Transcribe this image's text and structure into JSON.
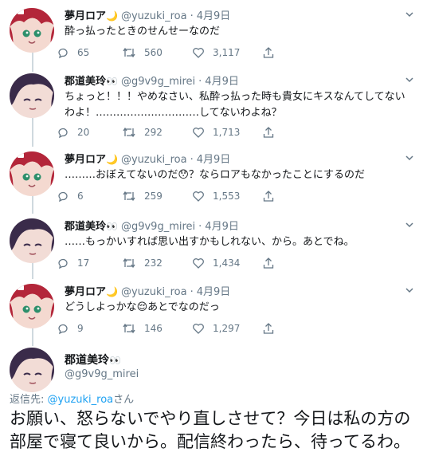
{
  "tweets": [
    {
      "name": "夢月ロア",
      "emoji": "🌙",
      "handle": "@yuzuki_roa",
      "date": "4月9日",
      "text": "酔っ払ったときのせんせーなのだ",
      "replies": "65",
      "retweets": "560",
      "likes": "3,117"
    },
    {
      "name": "郡道美玲",
      "emoji": "👀",
      "handle": "@g9v9g_mirei",
      "date": "4月9日",
      "text": "ちょっと！！！やめなさい、私酔っ払った時も貴女にキスなんてしてないわよ！…………………………してないわよね？",
      "replies": "20",
      "retweets": "292",
      "likes": "1,713"
    },
    {
      "name": "夢月ロア",
      "emoji": "🌙",
      "handle": "@yuzuki_roa",
      "date": "4月9日",
      "text": "………おぼえてないのだ😯？ならロアもなかったことにするのだ",
      "replies": "6",
      "retweets": "259",
      "likes": "1,553"
    },
    {
      "name": "郡道美玲",
      "emoji": "👀",
      "handle": "@g9v9g_mirei",
      "date": "4月9日",
      "text": "……もっかいすれば思い出すかもしれない、から。あとでね。",
      "replies": "17",
      "retweets": "232",
      "likes": "1,434"
    },
    {
      "name": "夢月ロア",
      "emoji": "🌙",
      "handle": "@yuzuki_roa",
      "date": "4月9日",
      "text": "どうしよっかな😌あとでなのだっ",
      "replies": "9",
      "retweets": "146",
      "likes": "1,297"
    }
  ],
  "main": {
    "name": "郡道美玲",
    "emoji": "👀",
    "handle": "@g9v9g_mirei",
    "reply_prefix": "返信先: ",
    "reply_to": "@yuzuki_roa",
    "reply_suffix": "さん",
    "text": "お願い、怒らないでやり直しさせて？今日は私の方の部屋で寝て良いから。配信終わったら、待ってるわ。"
  },
  "colors": {
    "roa_hair": "#b3263a",
    "mirei_hair": "#3a2b4a",
    "thread_line": "#cfd9de",
    "muted_text": "#657786",
    "link": "#1da1f2"
  }
}
